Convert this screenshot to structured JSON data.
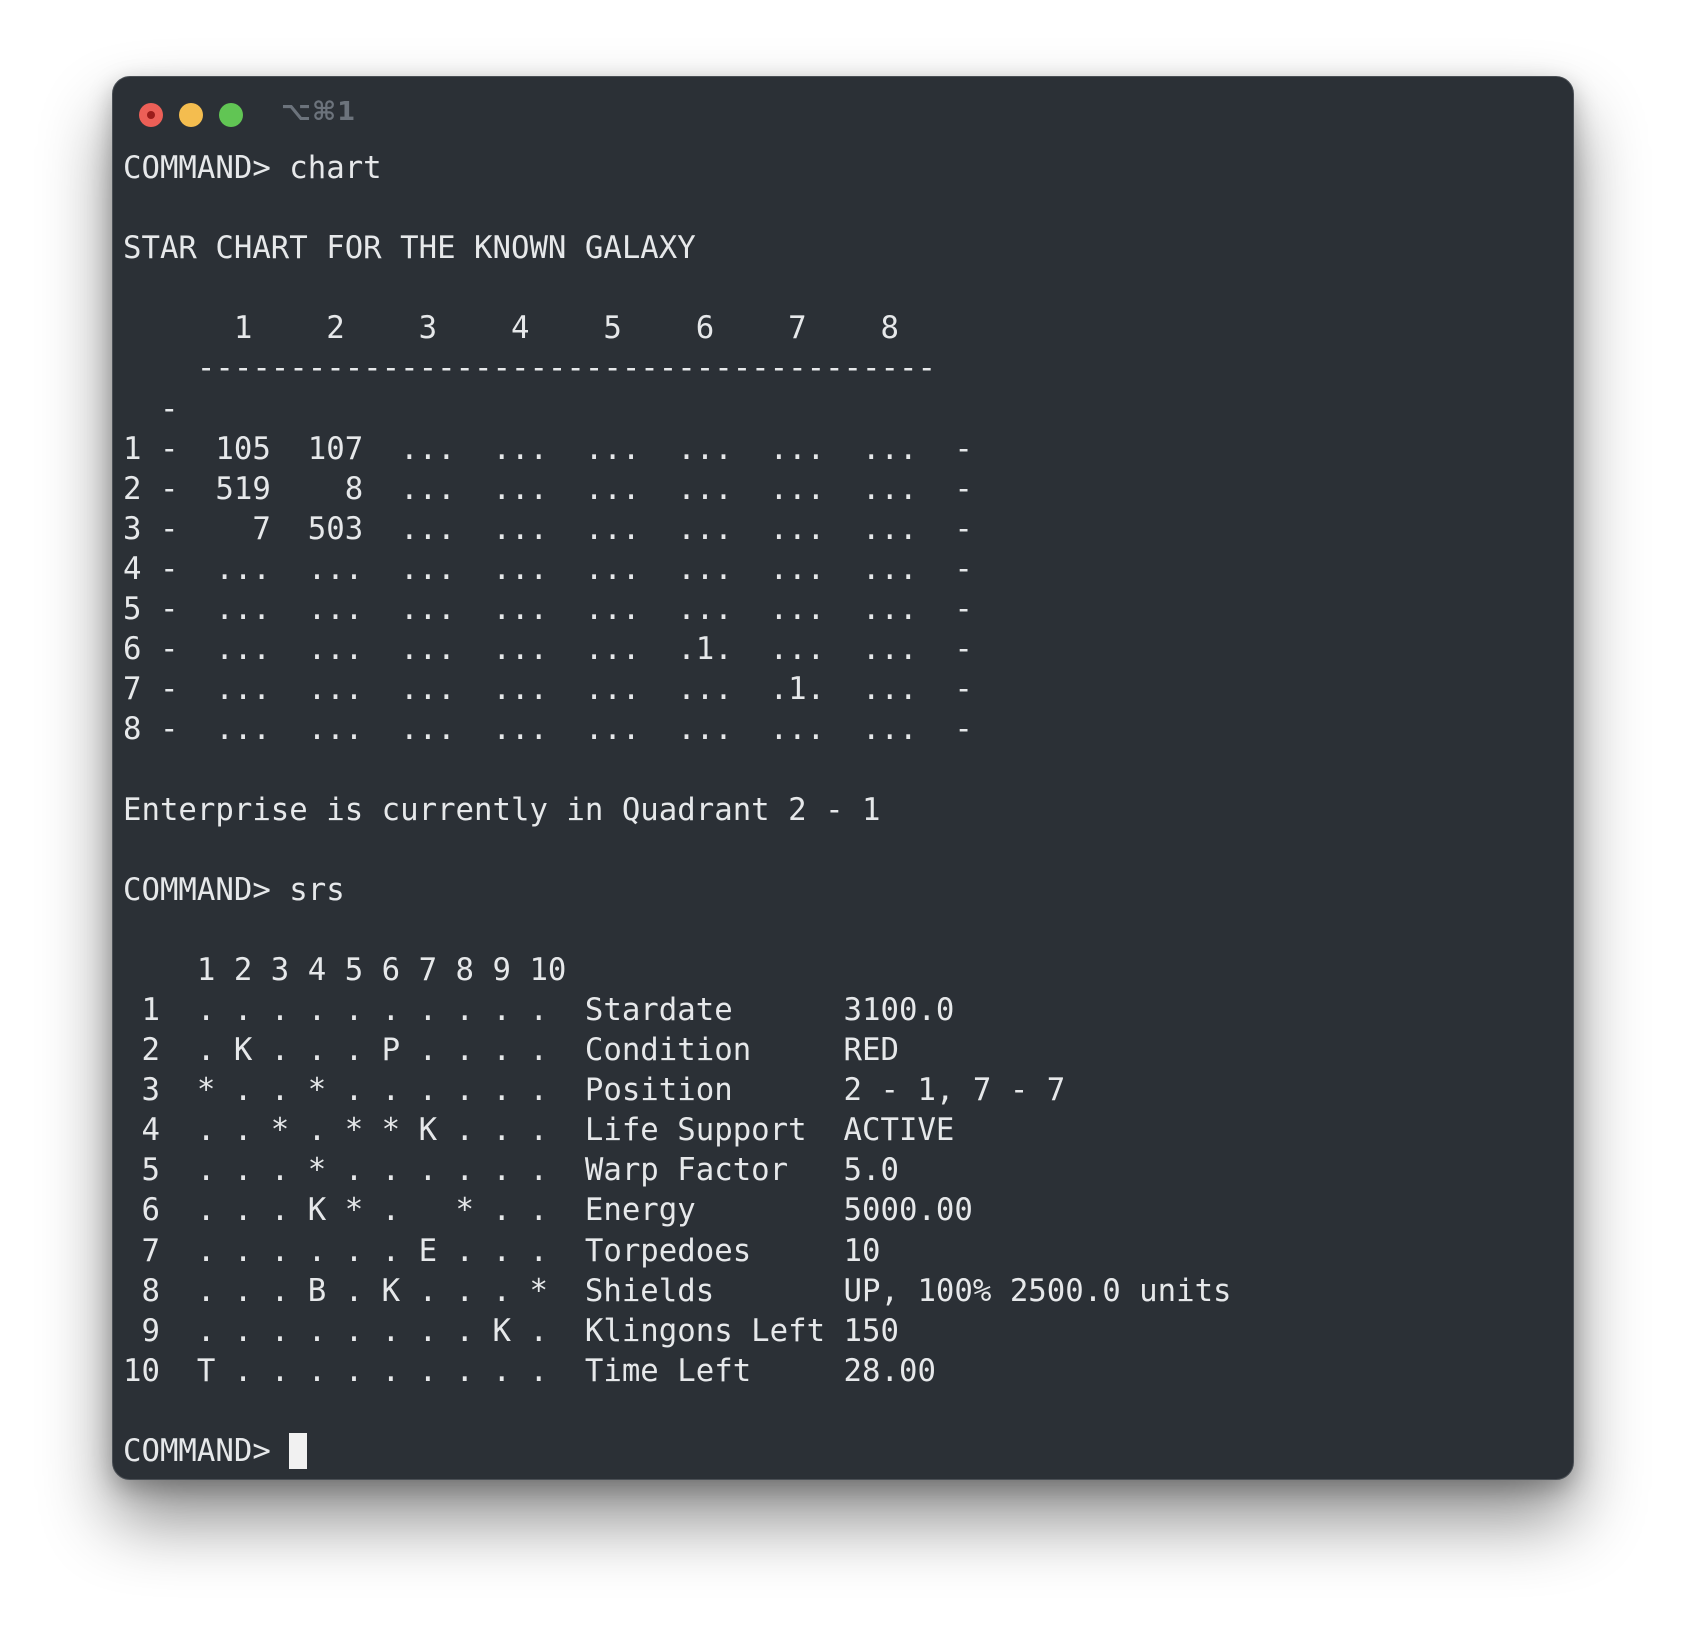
{
  "window": {
    "tab_title": "⌥⌘1"
  },
  "terminal": {
    "lines": [
      "COMMAND> chart",
      "",
      "STAR CHART FOR THE KNOWN GALAXY",
      "",
      "      1    2    3    4    5    6    7    8",
      "    ----------------------------------------",
      "  -",
      "1 -  105  107  ...  ...  ...  ...  ...  ...  -",
      "2 -  519    8  ...  ...  ...  ...  ...  ...  -",
      "3 -    7  503  ...  ...  ...  ...  ...  ...  -",
      "4 -  ...  ...  ...  ...  ...  ...  ...  ...  -",
      "5 -  ...  ...  ...  ...  ...  ...  ...  ...  -",
      "6 -  ...  ...  ...  ...  ...  .1.  ...  ...  -",
      "7 -  ...  ...  ...  ...  ...  ...  .1.  ...  -",
      "8 -  ...  ...  ...  ...  ...  ...  ...  ...  -",
      "",
      "Enterprise is currently in Quadrant 2 - 1",
      "",
      "COMMAND> srs",
      "",
      "    1 2 3 4 5 6 7 8 9 10",
      " 1  . . . . . . . . . .  Stardate      3100.0",
      " 2  . K . . . P . . . .  Condition     RED",
      " 3  * . . * . . . . . .  Position      2 - 1, 7 - 7",
      " 4  . . * . * * K . . .  Life Support  ACTIVE",
      " 5  . . . * . . . . . .  Warp Factor   5.0",
      " 6  . . . K * .   * . .  Energy        5000.00",
      " 7  . . . . . . E . . .  Torpedoes     10",
      " 8  . . . B . K . . . *  Shields       UP, 100% 2500.0 units",
      " 9  . . . . . . . . K .  Klingons Left 150",
      "10  T . . . . . . . . .  Time Left     28.00",
      ""
    ],
    "prompt": "COMMAND> "
  },
  "colors": {
    "window_bg": "#2b3036",
    "text": "#e6e8ea",
    "close": "#ec5f57",
    "minimize": "#f4bd4f",
    "zoom": "#61c554"
  }
}
